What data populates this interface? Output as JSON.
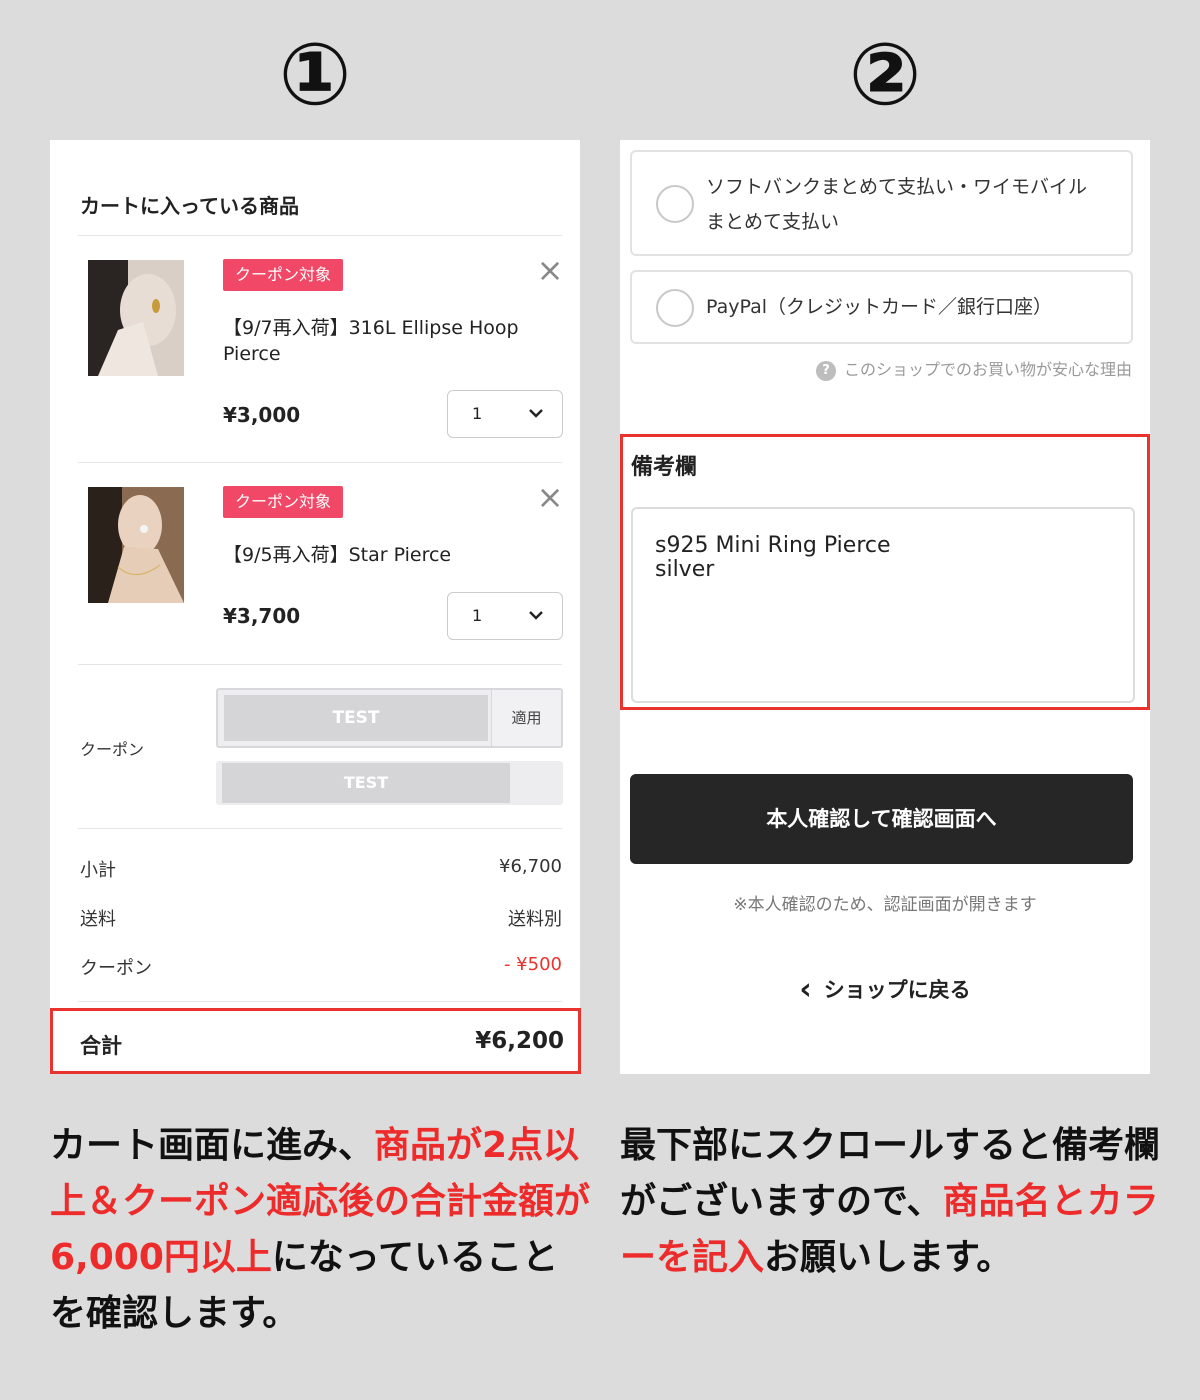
{
  "steps": {
    "one": "①",
    "two": "②"
  },
  "cart": {
    "title": "カートに入っている商品",
    "items": [
      {
        "badge": "クーポン対象",
        "name": "【9/7再入荷】316L Ellipse Hoop Pierce",
        "price": "¥3,000",
        "qty": "1"
      },
      {
        "badge": "クーポン対象",
        "name": "【9/5再入荷】Star Pierce",
        "price": "¥3,700",
        "qty": "1"
      }
    ],
    "remove_icon": "×",
    "coupon": {
      "label": "クーポン",
      "input_value": "TEST",
      "apply_label": "適用",
      "applied_chip": "TEST"
    },
    "summary": [
      {
        "label": "小計",
        "value": "¥6,700"
      },
      {
        "label": "送料",
        "value": "送料別"
      },
      {
        "label": "クーポン",
        "value": "- ¥500"
      }
    ],
    "total": {
      "label": "合計",
      "value": "¥6,200"
    }
  },
  "checkout": {
    "payment_options": [
      {
        "line1": "ソフトバンクまとめて支払い・ワイモバイル",
        "line2": "まとめて支払い"
      },
      {
        "line1": "PayPal（クレジットカード／銀行口座）"
      }
    ],
    "reason_icon": "?",
    "reason_text": "このショップでのお買い物が安心な理由",
    "memo": {
      "title": "備考欄",
      "line1": "s925 Mini Ring Pierce",
      "line2": "silver"
    },
    "confirm_button": "本人確認して確認画面へ",
    "note": "※本人確認のため、認証画面が開きます",
    "back_icon": "‹",
    "back_link": "ショップに戻る"
  },
  "captions": {
    "left": {
      "p1": "カート画面に進み、",
      "red": "商品が2点以上＆クーポン適応後の合計金額が6,000円以上",
      "p2": "になっていることを確認します。"
    },
    "right": {
      "p1": "最下部にスクロールすると備考欄がございますので、",
      "red": "商品名とカラーを記入",
      "p2": "お願いします。"
    }
  },
  "colors": {
    "accent_red": "#e8332f",
    "badge_pink": "#f04866",
    "button_dark": "#262626"
  }
}
